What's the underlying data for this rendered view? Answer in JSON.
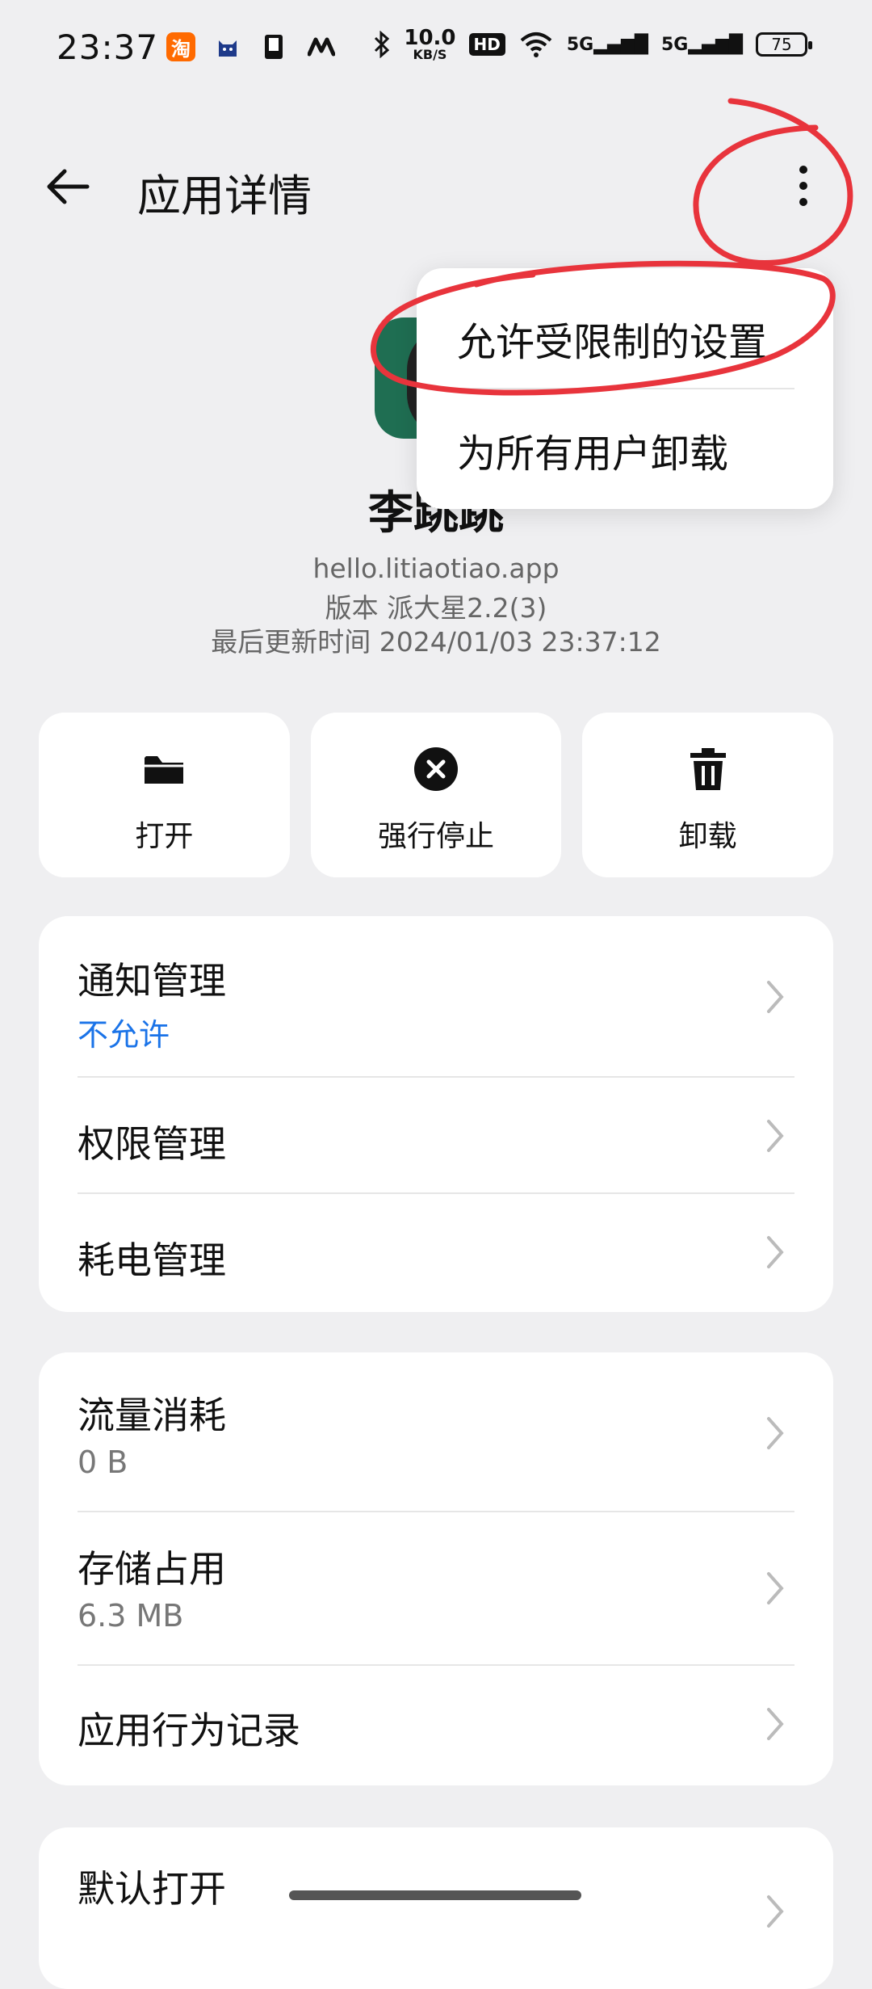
{
  "status_bar": {
    "time": "23:37",
    "net_speed_value": "10.0",
    "net_speed_unit": "KB/S",
    "hd_label": "HD",
    "signal1": "5G",
    "signal2": "5G",
    "battery": "75",
    "notification_icons": [
      "taobao-icon",
      "cat-icon",
      "phone-icon",
      "m-icon"
    ],
    "taobao_char": "淘"
  },
  "header": {
    "title": "应用详情"
  },
  "popup_menu": {
    "items": [
      {
        "label": "允许受限制的设置"
      },
      {
        "label": "为所有用户卸载"
      }
    ]
  },
  "app": {
    "name": "李跳跳",
    "package": "hello.litiaotiao.app",
    "version": "版本 派大星2.2(3)",
    "updated": "最后更新时间 2024/01/03 23:37:12"
  },
  "actions": [
    {
      "label": "打开",
      "icon": "folder-icon"
    },
    {
      "label": "强行停止",
      "icon": "close-circle-icon"
    },
    {
      "label": "卸载",
      "icon": "trash-icon"
    }
  ],
  "card1": {
    "rows": [
      {
        "title": "通知管理",
        "subtitle": "不允许"
      },
      {
        "title": "权限管理"
      },
      {
        "title": "耗电管理"
      }
    ]
  },
  "card2": {
    "rows": [
      {
        "title": "流量消耗",
        "subtitle": "0 B"
      },
      {
        "title": "存储占用",
        "subtitle": "6.3 MB"
      },
      {
        "title": "应用行为记录"
      }
    ]
  },
  "card3": {
    "rows": [
      {
        "title": "默认打开"
      }
    ]
  },
  "colors": {
    "background": "#efeff1",
    "card": "#ffffff",
    "accent_blue": "#1a73e8",
    "annotation_red": "#e8343c"
  }
}
